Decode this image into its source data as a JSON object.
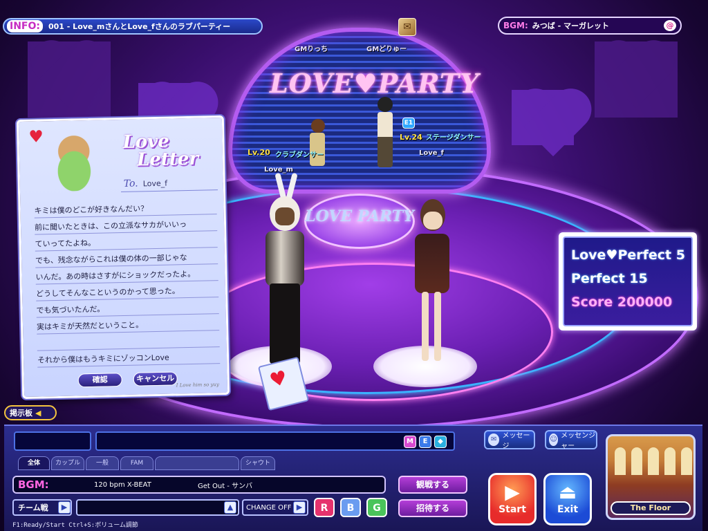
{
  "info_bar": {
    "tag": "INFO:",
    "text": "001 - Love_mさんとLove_fさんのラブパーティー"
  },
  "bgm_top": {
    "tag": "BGM:",
    "text": "みつば - マーガレット",
    "icon": "@"
  },
  "stage": {
    "logo": "LOVE♥PARTY",
    "disc_text": "LOVE PARTY",
    "gm_names": [
      "GMりっち",
      "GMどりゅー"
    ]
  },
  "characters": {
    "left_dancer": {
      "level": "Lv.20",
      "title": "クラブダンサー",
      "name": "Love_m"
    },
    "right_dancer": {
      "level": "Lv.24",
      "title": "ステージダンサー",
      "name": "Love_f",
      "badge": "E1"
    }
  },
  "letter": {
    "title_line1": "Love",
    "title_line2": "Letter",
    "to_label": "To.",
    "to_name": "Love_f",
    "lines": [
      "キミは僕のどこが好きなんだい？",
      "前に聞いたときは、この立派なサカがいいっ",
      "ていってたよね。",
      "でも、残念ながらこれは僕の体の一部じゃな",
      "いんだ。あの時はさすがにショックだったよ。",
      "どうしてそんなこというのかって思った。",
      "でも気づいたんだ。",
      "実はキミが天然だということ。",
      "",
      "それから僕はもうキミにゾッコンLove"
    ],
    "confirm_label": "確認",
    "cancel_label": "キャンセル",
    "signature": "I Love him so yuy"
  },
  "score": {
    "love_perfect": "Love♥Perfect 5",
    "perfect": "Perfect  15",
    "score": "Score 200000"
  },
  "bbs": {
    "label": "掲示板"
  },
  "chat": {
    "mode_buttons": [
      "M",
      "E",
      "◆"
    ],
    "message_button": "メッセージ",
    "messenger_button": "メッセンジャー",
    "tabs": [
      "全体",
      "カップル",
      "一般",
      "FAM",
      "",
      "シャウト"
    ]
  },
  "bgm_bar": {
    "label": "BGM:",
    "bpm": "120 bpm X-BEAT",
    "song": "Get Out - サンバ"
  },
  "team": {
    "label": "チーム戦",
    "change_label": "CHANGE OFF"
  },
  "rbg": [
    "R",
    "B",
    "G"
  ],
  "actions": {
    "spectate": "観戦する",
    "invite": "招待する"
  },
  "big_buttons": {
    "start": "Start",
    "exit": "Exit"
  },
  "floor_preview": {
    "label": "The Floor"
  },
  "help": "F1:Ready/Start   Ctrl+S:ボリューム調節",
  "colors": {
    "accent_pink": "#ff66e2",
    "panel_blue": "#2c2d8f",
    "start_red": "#e72b2b",
    "exit_blue": "#1c4bd6"
  }
}
